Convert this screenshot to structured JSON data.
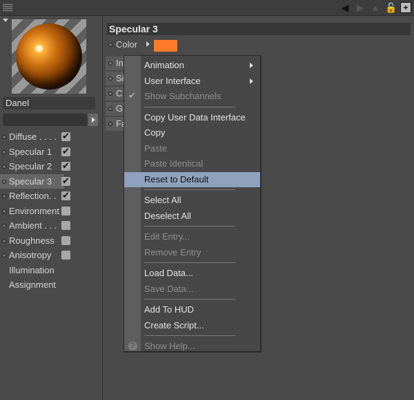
{
  "left": {
    "material_name": "Danel",
    "channels": [
      {
        "label": "Diffuse . . . .",
        "checked": true,
        "dot": true,
        "selected": false
      },
      {
        "label": "Specular 1",
        "checked": true,
        "dot": true,
        "selected": false
      },
      {
        "label": "Specular 2",
        "checked": true,
        "dot": true,
        "selected": false
      },
      {
        "label": "Specular 3",
        "checked": true,
        "dot": true,
        "selected": true
      },
      {
        "label": "Reflection. .",
        "checked": true,
        "dot": true,
        "selected": false
      },
      {
        "label": "Environment",
        "checked": false,
        "dot": true,
        "selected": false
      },
      {
        "label": "Ambient . . .",
        "checked": false,
        "dot": true,
        "selected": false
      },
      {
        "label": "Roughness",
        "checked": false,
        "dot": true,
        "selected": false
      },
      {
        "label": "Anisotropy",
        "checked": false,
        "dot": true,
        "selected": false
      },
      {
        "label": "Illumination",
        "checked": null,
        "dot": false,
        "selected": false
      },
      {
        "label": "Assignment",
        "checked": null,
        "dot": false,
        "selected": false
      }
    ]
  },
  "right": {
    "section_title": "Specular 3",
    "color_label": "Color",
    "swatch_color": "#ff7a2a",
    "stubs": [
      "In",
      "Si",
      "C",
      "G",
      "Fa"
    ]
  },
  "menu": {
    "items": [
      {
        "label": "Animation",
        "submenu": true,
        "disabled": false
      },
      {
        "label": "User Interface",
        "submenu": true,
        "disabled": false
      },
      {
        "label": "Show Subchannels",
        "disabled": true,
        "check": "✔"
      },
      {
        "sep": true
      },
      {
        "label": "Copy User Data Interface",
        "disabled": false
      },
      {
        "label": "Copy",
        "disabled": false
      },
      {
        "label": "Paste",
        "disabled": true
      },
      {
        "label": "Paste Identical",
        "disabled": true
      },
      {
        "label": "Reset to Default",
        "disabled": false,
        "highlight": true
      },
      {
        "sep": true
      },
      {
        "label": "Select All",
        "disabled": false
      },
      {
        "label": "Deselect All",
        "disabled": false
      },
      {
        "sep": true
      },
      {
        "label": "Edit Entry...",
        "disabled": true
      },
      {
        "label": "Remove Entry",
        "disabled": true
      },
      {
        "sep": true
      },
      {
        "label": "Load Data...",
        "disabled": false
      },
      {
        "label": "Save Data...",
        "disabled": true
      },
      {
        "sep": true
      },
      {
        "label": "Add To HUD",
        "disabled": false
      },
      {
        "label": "Create Script...",
        "disabled": false
      },
      {
        "sep": true
      },
      {
        "label": "Show Help...",
        "disabled": true,
        "help": "?"
      }
    ]
  },
  "toolbar_icons": [
    "back-arrow-icon",
    "forward-arrow-icon",
    "up-arrow-icon",
    "lock-icon",
    "new-window-icon"
  ]
}
